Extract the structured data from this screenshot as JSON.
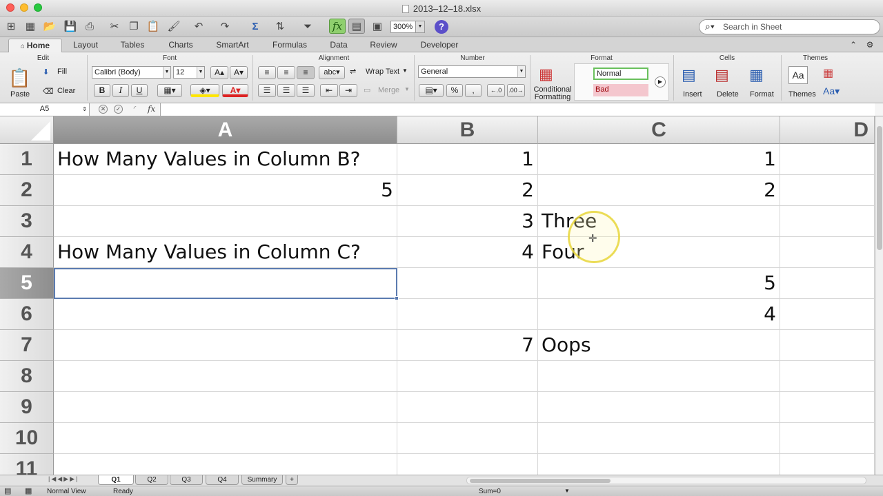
{
  "window": {
    "title": "2013–12–18.xlsx"
  },
  "toolbar": {
    "zoom": "300%",
    "help": "?",
    "search_placeholder": "Search in Sheet"
  },
  "tabs": [
    "Home",
    "Layout",
    "Tables",
    "Charts",
    "SmartArt",
    "Formulas",
    "Data",
    "Review",
    "Developer"
  ],
  "ribbon": {
    "groups": {
      "edit": "Edit",
      "font": "Font",
      "alignment": "Alignment",
      "number": "Number",
      "format": "Format",
      "cells": "Cells",
      "themes": "Themes"
    },
    "paste": "Paste",
    "fill": "Fill",
    "clear": "Clear",
    "font_name": "Calibri (Body)",
    "font_size": "12",
    "bold": "B",
    "italic": "I",
    "underline": "U",
    "wrap_text": "Wrap Text",
    "merge": "Merge",
    "abc": "abc",
    "number_format": "General",
    "percent": "%",
    "comma": ",",
    "conditional_formatting_1": "Conditional",
    "conditional_formatting_2": "Formatting",
    "style_normal": "Normal",
    "style_bad": "Bad",
    "insert": "Insert",
    "delete": "Delete",
    "format": "Format",
    "themes": "Themes",
    "font_grow": "A",
    "font_shrink": "A",
    "aa": "Aa"
  },
  "formula_bar": {
    "name_box": "A5",
    "fx": "fx",
    "content": ""
  },
  "columns": [
    "A",
    "B",
    "C",
    "D"
  ],
  "rows": [
    "1",
    "2",
    "3",
    "4",
    "5",
    "6",
    "7",
    "8",
    "9",
    "10",
    "11"
  ],
  "cells": {
    "A1": "How Many Values in Column B?",
    "B1": "1",
    "C1": "1",
    "A2": "5",
    "B2": "2",
    "C2": "2",
    "B3": "3",
    "C3": "Three",
    "A4": "How Many Values in Column C?",
    "B4": "4",
    "C4": "Four",
    "C5": "5",
    "C6": "4",
    "B7": "7",
    "C7": "Oops"
  },
  "active_cell": "A5",
  "sheets": [
    "Q1",
    "Q2",
    "Q3",
    "Q4",
    "Summary"
  ],
  "active_sheet": "Q1",
  "status": {
    "view": "Normal View",
    "ready": "Ready",
    "sum": "Sum=0"
  },
  "colors": {
    "selection": "#5b7bb0",
    "normal_style_border": "#69c05c",
    "bad_style_bg": "#f4c7ce"
  }
}
